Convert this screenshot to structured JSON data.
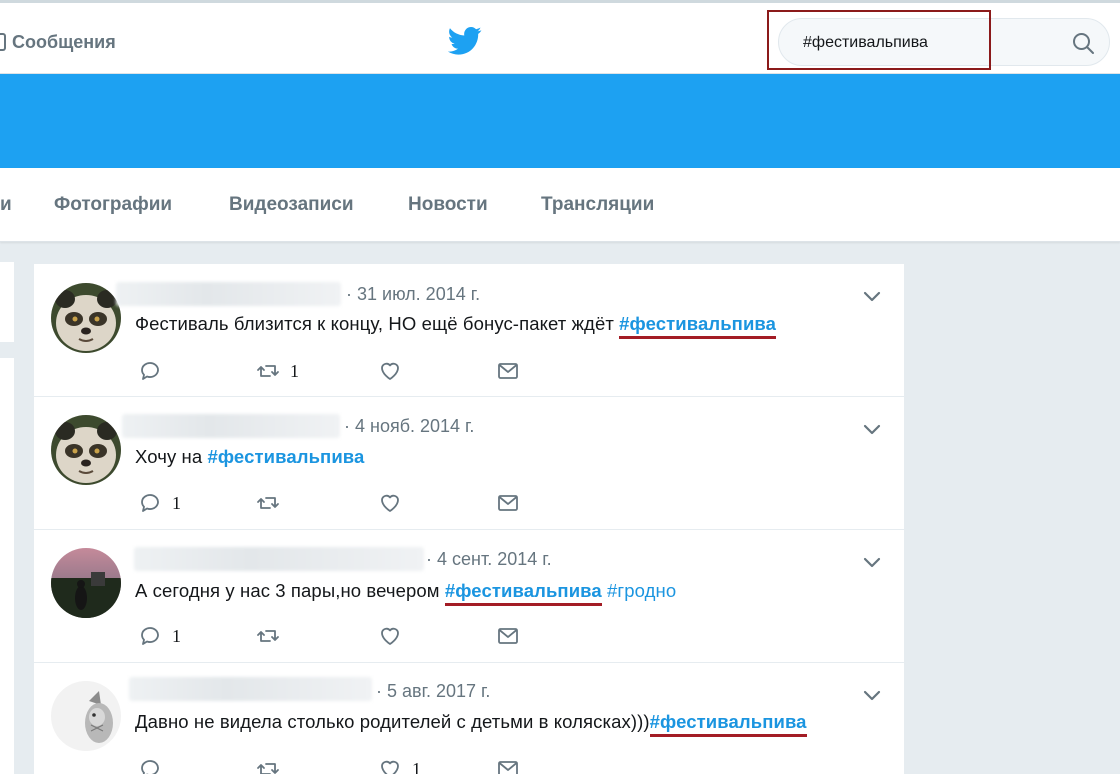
{
  "header": {
    "messages_label": "Сообщения",
    "search_value": "#фестивальпива"
  },
  "tabs": [
    {
      "label": "и"
    },
    {
      "label": "Фотографии"
    },
    {
      "label": "Видеозаписи"
    },
    {
      "label": "Новости"
    },
    {
      "label": "Трансляции"
    }
  ],
  "tweets": [
    {
      "date": "· 31 июл. 2014 г.",
      "text": "Фестиваль близится к концу, НО ещё бонус-пакет ждёт ",
      "hashtag": "#фестивальпива",
      "hashtag2": "",
      "reply_count": "",
      "retweet_count": "1",
      "like_count": ""
    },
    {
      "date": "· 4 нояб. 2014 г.",
      "text": "Хочу на ",
      "hashtag": "#фестивальпива",
      "hashtag2": "",
      "reply_count": "1",
      "retweet_count": "",
      "like_count": ""
    },
    {
      "date": "· 4 сент. 2014 г.",
      "text": "А сегодня у нас 3 пары,но вечером ",
      "hashtag": "#фестивальпива",
      "hashtag2": " #гродно",
      "reply_count": "1",
      "retweet_count": "",
      "like_count": ""
    },
    {
      "date": "· 5 авг. 2017 г.",
      "text": "Давно не видела столько родителей с детьми в колясках)))",
      "hashtag": "#фестивальпива",
      "hashtag2": "",
      "reply_count": "",
      "retweet_count": "",
      "like_count": "1"
    }
  ],
  "colors": {
    "brand": "#1da1f2",
    "hashtag": "#1b95e0",
    "annotation": "#a31c25"
  }
}
